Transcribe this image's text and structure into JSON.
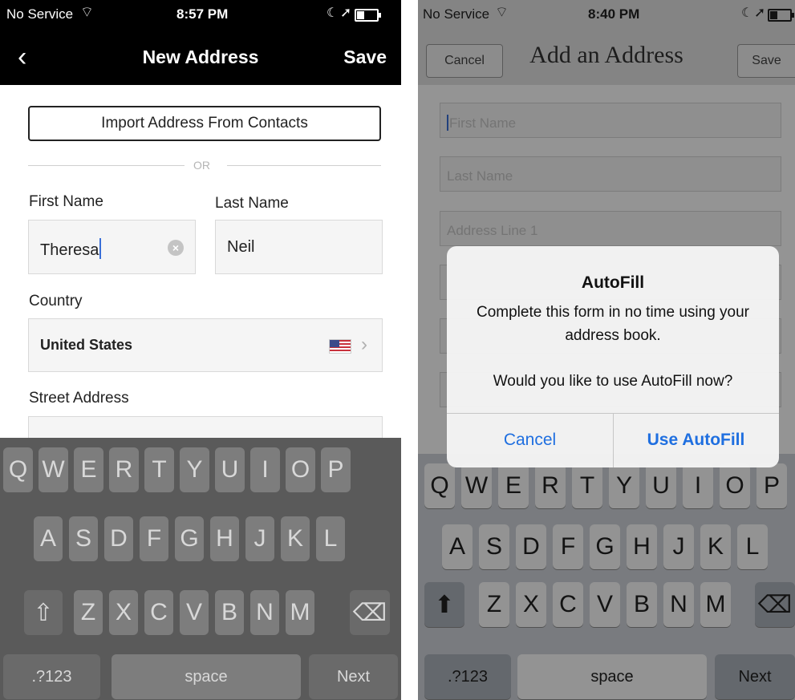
{
  "left": {
    "status": {
      "carrier": "No Service",
      "time": "8:57 PM"
    },
    "nav": {
      "back": "‹",
      "title": "New Address",
      "save": "Save"
    },
    "import_label": "Import Address From Contacts",
    "or_label": "OR",
    "first_name": {
      "label": "First Name",
      "value": "Theresa"
    },
    "last_name": {
      "label": "Last Name",
      "value": "Neil"
    },
    "country": {
      "label": "Country",
      "value": "United States"
    },
    "street": {
      "label": "Street Address",
      "value": ""
    },
    "keyboard": {
      "row1": [
        "Q",
        "W",
        "E",
        "R",
        "T",
        "Y",
        "U",
        "I",
        "O",
        "P"
      ],
      "row2": [
        "A",
        "S",
        "D",
        "F",
        "G",
        "H",
        "J",
        "K",
        "L"
      ],
      "row3": [
        "Z",
        "X",
        "C",
        "V",
        "B",
        "N",
        "M"
      ],
      "shift": "⇧",
      "delete": "⌫",
      "numbers": ".?123",
      "space": "space",
      "next": "Next"
    }
  },
  "right": {
    "status": {
      "carrier": "No Service",
      "time": "8:40 PM"
    },
    "nav": {
      "cancel": "Cancel",
      "title": "Add an Address",
      "save": "Save"
    },
    "placeholders": {
      "first_name": "First Name",
      "last_name": "Last Name",
      "address1": "Address Line 1"
    },
    "alert": {
      "title": "AutoFill",
      "message": "Complete this form in no time using your address book.",
      "question": "Would you like to use AutoFill now?",
      "cancel": "Cancel",
      "confirm": "Use AutoFill"
    },
    "keyboard": {
      "row1": [
        "Q",
        "W",
        "E",
        "R",
        "T",
        "Y",
        "U",
        "I",
        "O",
        "P"
      ],
      "row2": [
        "A",
        "S",
        "D",
        "F",
        "G",
        "H",
        "J",
        "K",
        "L"
      ],
      "row3": [
        "Z",
        "X",
        "C",
        "V",
        "B",
        "N",
        "M"
      ],
      "shift": "⬆",
      "delete": "⌫",
      "numbers": ".?123",
      "space": "space",
      "next": "Next"
    }
  },
  "colors": {
    "accent": "#1f6fe0",
    "caret": "#3a6fd8",
    "nav_dark": "#000000"
  }
}
